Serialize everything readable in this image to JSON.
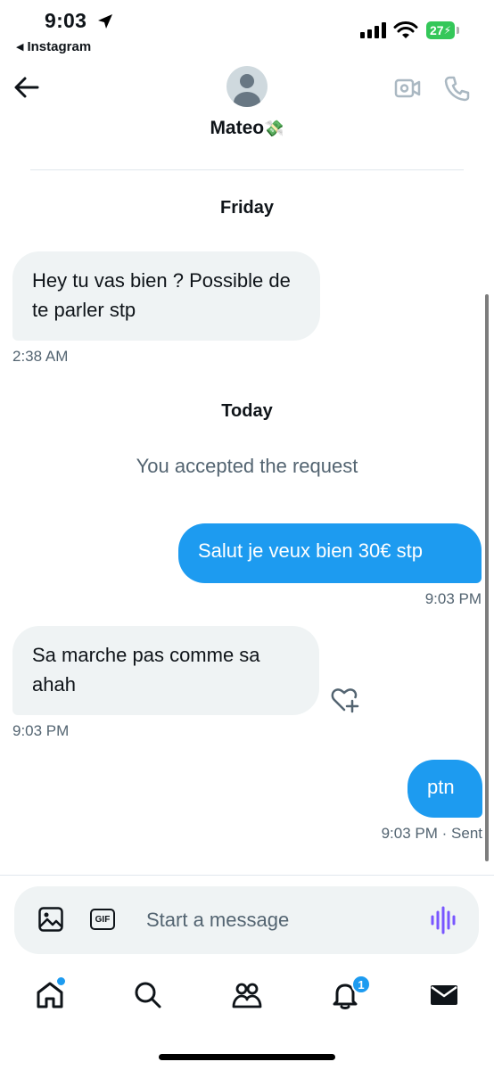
{
  "status_bar": {
    "time": "9:03",
    "back_app": "Instagram",
    "battery": "27"
  },
  "header": {
    "contact_name": "Mateo",
    "contact_emoji": "💸"
  },
  "conversation": {
    "day_friday": "Friday",
    "msg1": {
      "text": "Hey tu vas bien ? Possible de te parler stp",
      "time": "2:38 AM"
    },
    "day_today": "Today",
    "system_note": "You accepted the request",
    "msg2": {
      "text": "Salut je veux bien 30€ stp",
      "time": "9:03 PM"
    },
    "msg3": {
      "text": "Sa marche pas comme sa ahah",
      "time": "9:03 PM"
    },
    "msg4": {
      "text": "ptn",
      "time": "9:03 PM",
      "status": "· Sent"
    }
  },
  "composer": {
    "placeholder": "Start a message",
    "gif_label": "GIF"
  },
  "tab_bar": {
    "notifications_count": "1"
  },
  "colors": {
    "accent": "#1d9bf0",
    "incoming_bubble": "#eff3f4",
    "secondary_text": "#536471",
    "battery": "#34c759",
    "voice_icon": "#7856ff"
  },
  "icons": {
    "back": "arrow-left-icon",
    "video": "video-call-icon",
    "phone": "phone-icon",
    "media": "image-icon",
    "voice": "voice-wave-icon",
    "react": "heart-plus-icon",
    "home": "home-icon",
    "search": "search-icon",
    "communities": "people-icon",
    "notifications": "bell-icon",
    "messages": "envelope-icon"
  }
}
